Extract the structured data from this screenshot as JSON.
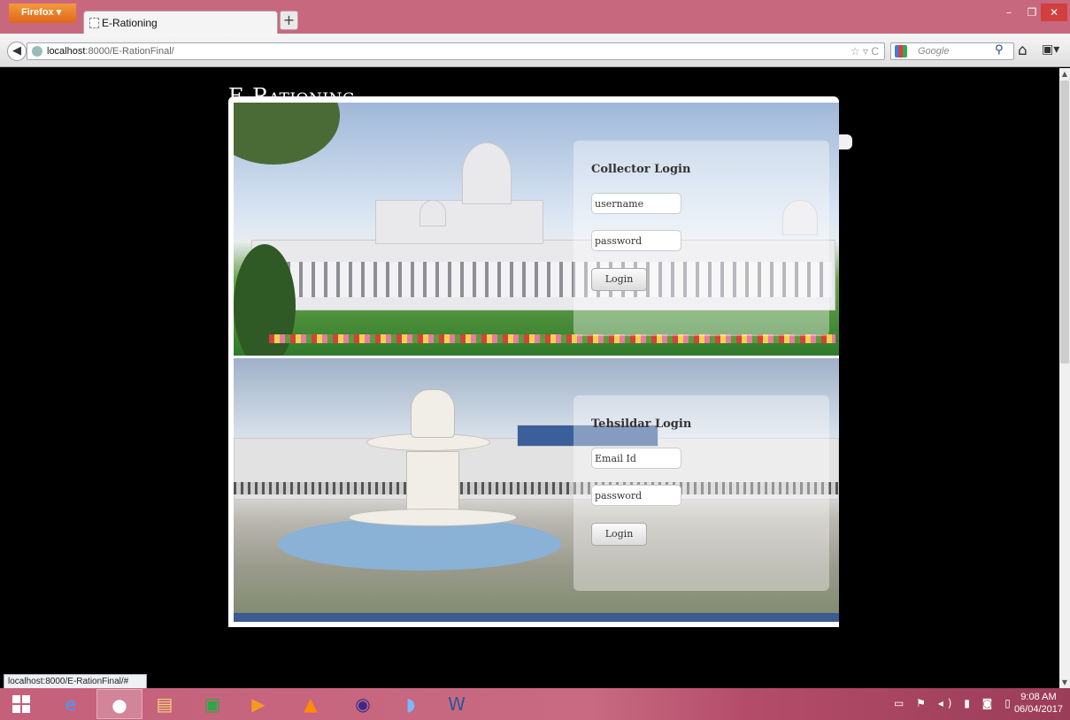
{
  "browser": {
    "menu_button": "Firefox ▾",
    "tab_title": "E-Rationing",
    "new_tab": "+",
    "url_host": "localhost",
    "url_path": ":8000/E-RationFinal/",
    "url_icons": "☆ ▿ C",
    "search_engine_placeholder": "Google",
    "window_controls": {
      "minimize": "–",
      "restore": "❐",
      "close": "✕"
    },
    "status_url": "localhost:8000/E-RationFinal/#"
  },
  "page": {
    "site_title": "E-Rationing"
  },
  "collector_login": {
    "title": "Collector Login",
    "username_placeholder": "username",
    "password_placeholder": "password",
    "button": "Login"
  },
  "tehsildar_login": {
    "title": "Tehsildar Login",
    "email_placeholder": "Email Id",
    "password_placeholder": "password",
    "button": "Login"
  },
  "taskbar": {
    "apps": [
      "internet-explorer",
      "firefox",
      "file-explorer",
      "store",
      "media-player",
      "vlc",
      "eclipse",
      "netbeans",
      "word"
    ],
    "time": "9:08 AM",
    "date": "06/04/2017"
  }
}
